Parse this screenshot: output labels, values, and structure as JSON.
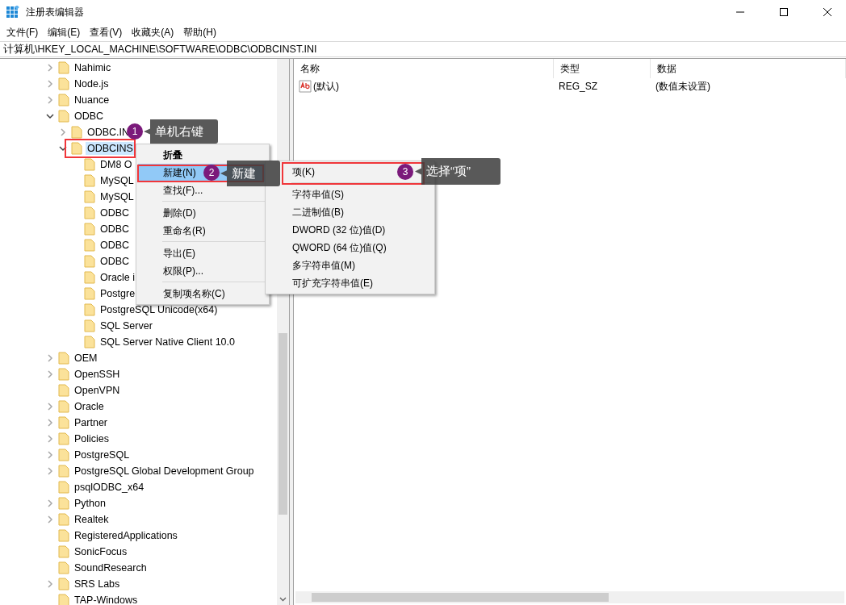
{
  "window": {
    "title": "注册表编辑器"
  },
  "menu_bar": [
    "文件(F)",
    "编辑(E)",
    "查看(V)",
    "收藏夹(A)",
    "帮助(H)"
  ],
  "address_bar": {
    "value": "计算机\\HKEY_LOCAL_MACHINE\\SOFTWARE\\ODBC\\ODBCINST.INI"
  },
  "tree": [
    {
      "label": "Nahimic",
      "expandable": true,
      "expanded": false,
      "selected": false
    },
    {
      "label": "Node.js",
      "expandable": true,
      "expanded": false,
      "selected": false
    },
    {
      "label": "Nuance",
      "expandable": true,
      "expanded": false,
      "selected": false
    },
    {
      "label": "ODBC",
      "expandable": true,
      "expanded": true,
      "selected": false,
      "children": [
        {
          "label": "ODBC.IN",
          "expandable": true,
          "expanded": false,
          "selected": false
        },
        {
          "label": "ODBCINS",
          "expandable": true,
          "expanded": true,
          "selected": true,
          "children": [
            {
              "label": "DM8 O",
              "expandable": false,
              "selected": false
            },
            {
              "label": "MySQL",
              "expandable": false,
              "selected": false
            },
            {
              "label": "MySQL",
              "expandable": false,
              "selected": false
            },
            {
              "label": "ODBC",
              "expandable": false,
              "selected": false
            },
            {
              "label": "ODBC",
              "expandable": false,
              "selected": false
            },
            {
              "label": "ODBC",
              "expandable": false,
              "selected": false
            },
            {
              "label": "ODBC",
              "expandable": false,
              "selected": false
            },
            {
              "label": "Oracle i",
              "expandable": false,
              "selected": false
            },
            {
              "label": "Postgre",
              "expandable": false,
              "selected": false
            },
            {
              "label": "PostgreSQL Unicode(x64)",
              "expandable": false,
              "selected": false
            },
            {
              "label": "SQL Server",
              "expandable": false,
              "selected": false
            },
            {
              "label": "SQL Server Native Client 10.0",
              "expandable": false,
              "selected": false
            }
          ]
        }
      ]
    },
    {
      "label": "OEM",
      "expandable": true,
      "expanded": false,
      "selected": false
    },
    {
      "label": "OpenSSH",
      "expandable": true,
      "expanded": false,
      "selected": false
    },
    {
      "label": "OpenVPN",
      "expandable": false,
      "selected": false
    },
    {
      "label": "Oracle",
      "expandable": true,
      "expanded": false,
      "selected": false
    },
    {
      "label": "Partner",
      "expandable": true,
      "expanded": false,
      "selected": false
    },
    {
      "label": "Policies",
      "expandable": true,
      "expanded": false,
      "selected": false
    },
    {
      "label": "PostgreSQL",
      "expandable": true,
      "expanded": false,
      "selected": false
    },
    {
      "label": "PostgreSQL Global Development Group",
      "expandable": true,
      "expanded": false,
      "selected": false
    },
    {
      "label": "psqlODBC_x64",
      "expandable": false,
      "selected": false
    },
    {
      "label": "Python",
      "expandable": true,
      "expanded": false,
      "selected": false
    },
    {
      "label": "Realtek",
      "expandable": true,
      "expanded": false,
      "selected": false
    },
    {
      "label": "RegisteredApplications",
      "expandable": false,
      "selected": false
    },
    {
      "label": "SonicFocus",
      "expandable": false,
      "selected": false
    },
    {
      "label": "SoundResearch",
      "expandable": false,
      "selected": false
    },
    {
      "label": "SRS Labs",
      "expandable": true,
      "expanded": false,
      "selected": false
    },
    {
      "label": "TAP-Windows",
      "expandable": false,
      "selected": false
    }
  ],
  "values_table": {
    "columns": [
      "名称",
      "类型",
      "数据"
    ],
    "rows": [
      {
        "name": "(默认)",
        "type": "REG_SZ",
        "data": "(数值未设置)"
      }
    ]
  },
  "context_menu": {
    "items": [
      {
        "kind": "item",
        "label": "折叠",
        "bold": true,
        "highlighted": false
      },
      {
        "kind": "item",
        "label": "新建(N)",
        "bold": false,
        "highlighted": true
      },
      {
        "kind": "item",
        "label": "查找(F)...",
        "bold": false,
        "highlighted": false
      },
      {
        "kind": "separator"
      },
      {
        "kind": "item",
        "label": "删除(D)",
        "bold": false,
        "highlighted": false
      },
      {
        "kind": "item",
        "label": "重命名(R)",
        "bold": false,
        "highlighted": false
      },
      {
        "kind": "separator"
      },
      {
        "kind": "item",
        "label": "导出(E)",
        "bold": false,
        "highlighted": false
      },
      {
        "kind": "item",
        "label": "权限(P)...",
        "bold": false,
        "highlighted": false
      },
      {
        "kind": "separator"
      },
      {
        "kind": "item",
        "label": "复制项名称(C)",
        "bold": false,
        "highlighted": false
      }
    ]
  },
  "submenu": {
    "items": [
      {
        "kind": "item",
        "label": "项(K)",
        "bold": false,
        "highlighted": false
      },
      {
        "kind": "separator"
      },
      {
        "kind": "item",
        "label": "字符串值(S)",
        "bold": false,
        "highlighted": false
      },
      {
        "kind": "item",
        "label": "二进制值(B)",
        "bold": false,
        "highlighted": false
      },
      {
        "kind": "item",
        "label": "DWORD (32 位)值(D)",
        "bold": false,
        "highlighted": false
      },
      {
        "kind": "item",
        "label": "QWORD (64 位)值(Q)",
        "bold": false,
        "highlighted": false
      },
      {
        "kind": "item",
        "label": "多字符串值(M)",
        "bold": false,
        "highlighted": false
      },
      {
        "kind": "item",
        "label": "可扩充字符串值(E)",
        "bold": false,
        "highlighted": false
      }
    ]
  },
  "annotations": [
    {
      "number": "1",
      "text": "单机右键"
    },
    {
      "number": "2",
      "text": "新建"
    },
    {
      "number": "3",
      "text": "选择“项”"
    }
  ]
}
